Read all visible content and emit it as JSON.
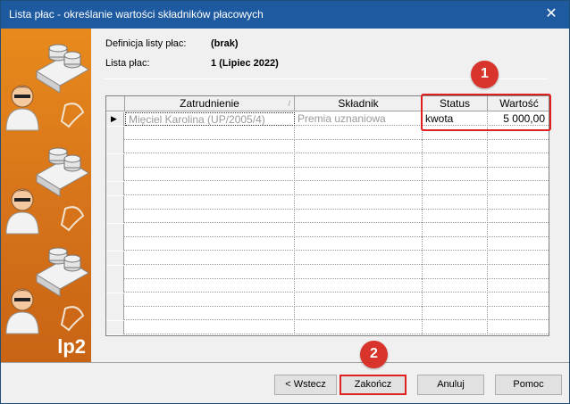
{
  "window": {
    "title": "Lista płac - określanie wartości składników płacowych",
    "close_glyph": "✕"
  },
  "side_panel": {
    "logo_text": "lp2"
  },
  "info": {
    "definition_label": "Definicja listy płac:",
    "definition_value": "(brak)",
    "payroll_label": "Lista płac:",
    "payroll_value": "1 (Lipiec 2022)"
  },
  "grid": {
    "columns": [
      "Zatrudnienie",
      "Składnik",
      "Status",
      "Wartość"
    ],
    "sort_indicator": "/",
    "row_pointer": "▶",
    "rows": [
      [
        "Mięciel Karolina (UP/2005/4)",
        "Premia uznaniowa",
        "kwota",
        "5 000,00"
      ]
    ]
  },
  "annotations": {
    "badge_1": "1",
    "badge_2": "2",
    "accent_color": "#d8342c"
  },
  "buttons": {
    "back": "< Wstecz",
    "finish": "Zakończ",
    "cancel": "Anuluj",
    "help": "Pomoc"
  }
}
